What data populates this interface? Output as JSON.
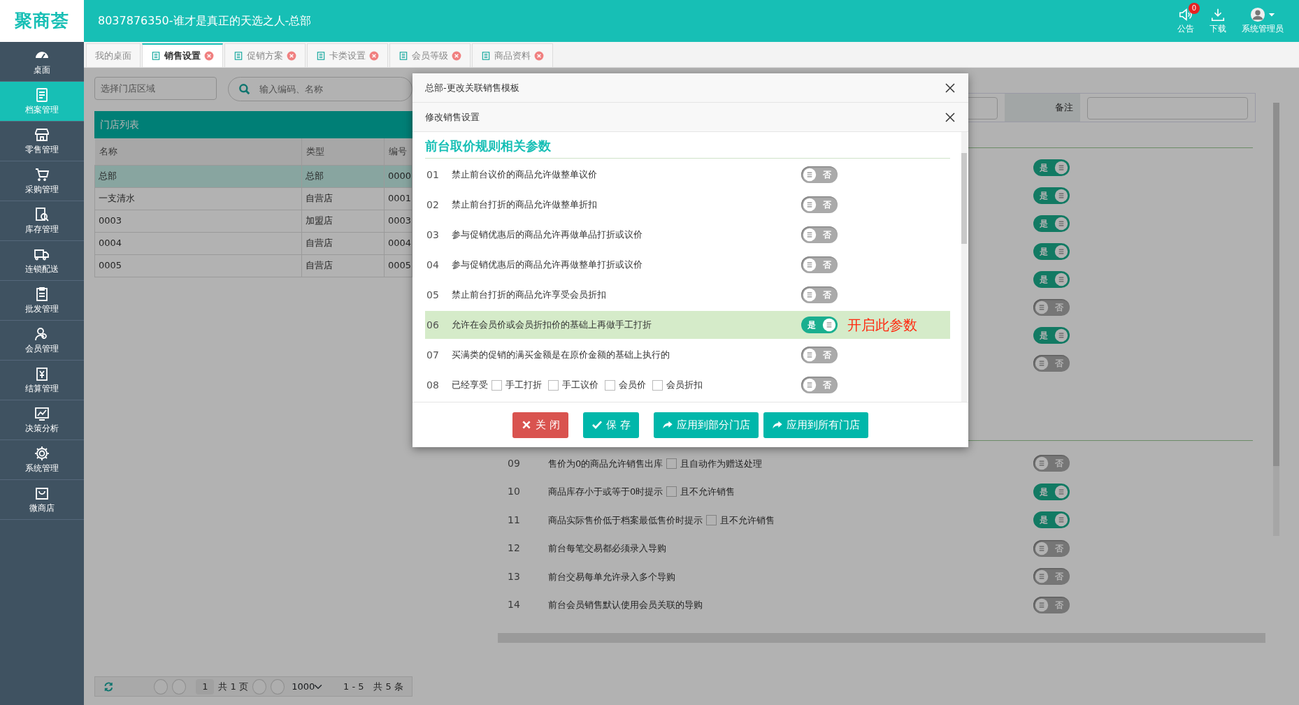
{
  "app": {
    "logo": "聚商荟",
    "title": "8037876350-谁才是真正的天选之人-总部",
    "actions": [
      {
        "kind": "notice",
        "label": "公告",
        "badge": "0"
      },
      {
        "kind": "download",
        "label": "下载"
      },
      {
        "kind": "user",
        "label": "系统管理员"
      }
    ]
  },
  "sidebar": {
    "items": [
      {
        "label": "桌面",
        "selected": false
      },
      {
        "label": "档案管理",
        "selected": true
      },
      {
        "label": "零售管理",
        "selected": false
      },
      {
        "label": "采购管理",
        "selected": false
      },
      {
        "label": "库存管理",
        "selected": false
      },
      {
        "label": "连锁配送",
        "selected": false
      },
      {
        "label": "批发管理",
        "selected": false
      },
      {
        "label": "会员管理",
        "selected": false
      },
      {
        "label": "结算管理",
        "selected": false
      },
      {
        "label": "决策分析",
        "selected": false
      },
      {
        "label": "系统管理",
        "selected": false
      },
      {
        "label": "微商店",
        "selected": false
      }
    ]
  },
  "tabs": [
    {
      "label": "我的桌面",
      "selected": false,
      "closable": false
    },
    {
      "label": "销售设置",
      "selected": true,
      "closable": true
    },
    {
      "label": "促销方案",
      "selected": false,
      "closable": true
    },
    {
      "label": "卡类设置",
      "selected": false,
      "closable": true
    },
    {
      "label": "会员等级",
      "selected": false,
      "closable": true
    },
    {
      "label": "商品资料",
      "selected": false,
      "closable": true
    }
  ],
  "store_panel": {
    "area_field": {
      "placeholder": "选择门店区域"
    },
    "search_field": {
      "placeholder": "输入编码、名称"
    },
    "title": "门店列表",
    "columns": [
      "名称",
      "类型",
      "编号"
    ],
    "rows": [
      {
        "cells": [
          "总部",
          "总部",
          "0000"
        ],
        "selected": true
      },
      {
        "cells": [
          "一支清水",
          "自营店",
          "0001"
        ],
        "selected": false
      },
      {
        "cells": [
          "0003",
          "加盟店",
          "0003"
        ],
        "selected": false
      },
      {
        "cells": [
          "0004",
          "自营店",
          "0004"
        ],
        "selected": false
      },
      {
        "cells": [
          "0005",
          "自营店",
          "0005"
        ],
        "selected": false
      }
    ],
    "pager": {
      "page": "1",
      "pages": "共 1 页",
      "page_size": "1000",
      "range": "1 - 5",
      "total": "共 5 条"
    }
  },
  "settings_panel": {
    "note_label": "备注",
    "covered_rows": [
      {
        "switch": {
          "on": true,
          "label": "是"
        }
      },
      {
        "switch": {
          "on": true,
          "label": "是"
        }
      },
      {
        "switch": {
          "on": true,
          "label": "是"
        }
      },
      {
        "switch": {
          "on": true,
          "label": "是"
        }
      },
      {
        "switch": {
          "on": true,
          "label": "是"
        }
      },
      {
        "switch": {
          "on": false,
          "label": "否"
        }
      },
      {
        "switch": {
          "on": true,
          "label": "是"
        }
      },
      {
        "switch": {
          "on": false,
          "label": "否"
        }
      }
    ],
    "rows": [
      {
        "number": "09",
        "text": "售价为0的商品允许销售出库",
        "options": [
          {
            "checked": false,
            "label": "且自动作为赠送处理"
          }
        ],
        "switch": {
          "on": false,
          "label": "否"
        }
      },
      {
        "number": "10",
        "text": "商品库存小于或等于0时提示",
        "options": [
          {
            "checked": false,
            "label": "且不允许销售"
          }
        ],
        "switch": {
          "on": true,
          "label": "是"
        }
      },
      {
        "number": "11",
        "text": "商品实际售价低于档案最低售价时提示",
        "options": [
          {
            "checked": false,
            "label": "且不允许销售"
          }
        ],
        "switch": {
          "on": true,
          "label": "是"
        }
      },
      {
        "number": "12",
        "text": "前台每笔交易都必须录入导购",
        "switch": {
          "on": false,
          "label": "否"
        }
      },
      {
        "number": "13",
        "text": "前台交易每单允许录入多个导购",
        "switch": {
          "on": false,
          "label": "否"
        }
      },
      {
        "number": "14",
        "text": "前台会员销售默认使用会员关联的导购",
        "switch": {
          "on": false,
          "label": "否"
        }
      }
    ]
  },
  "dialogs": [
    {
      "title": "总部-更改关联销售模板"
    },
    {
      "title": "修改销售设置"
    }
  ],
  "settings_dialog": {
    "section_title": "前台取价规则相关参数",
    "rows": [
      {
        "number": "01",
        "text": "禁止前台议价的商品允许做整单议价",
        "highlighted": false,
        "switch": {
          "on": false,
          "label": "否"
        }
      },
      {
        "number": "02",
        "text": "禁止前台打折的商品允许做整单折扣",
        "highlighted": false,
        "switch": {
          "on": false,
          "label": "否"
        }
      },
      {
        "number": "03",
        "text": "参与促销优惠后的商品允许再做单品打折或议价",
        "highlighted": false,
        "switch": {
          "on": false,
          "label": "否"
        }
      },
      {
        "number": "04",
        "text": "参与促销优惠后的商品允许再做整单打折或议价",
        "highlighted": false,
        "switch": {
          "on": false,
          "label": "否"
        }
      },
      {
        "number": "05",
        "text": "禁止前台打折的商品允许享受会员折扣",
        "highlighted": false,
        "switch": {
          "on": false,
          "label": "否"
        }
      },
      {
        "number": "06",
        "text": "允许在会员价或会员折扣价的基础上再做手工打折",
        "highlighted": true,
        "note": "开启此参数",
        "switch": {
          "on": true,
          "label": "是"
        }
      },
      {
        "number": "07",
        "text": "买满类的促销的满买金额是在原价金额的基础上执行的",
        "highlighted": false,
        "switch": {
          "on": false,
          "label": "否"
        }
      },
      {
        "number": "08",
        "text": "已经享受",
        "highlighted": false,
        "options": [
          {
            "checked": false,
            "label": "手工打折"
          },
          {
            "checked": false,
            "label": "手工议价"
          },
          {
            "checked": false,
            "label": "会员价"
          },
          {
            "checked": false,
            "label": "会员折扣"
          }
        ],
        "switch": {
          "on": false,
          "label": "否"
        }
      }
    ],
    "buttons": [
      {
        "kind": "close",
        "label": "关 闭"
      },
      {
        "kind": "save",
        "label": "保 存"
      },
      {
        "kind": "apply",
        "label": "应用到部分门店"
      },
      {
        "kind": "apply",
        "label": "应用到所有门店"
      }
    ]
  }
}
